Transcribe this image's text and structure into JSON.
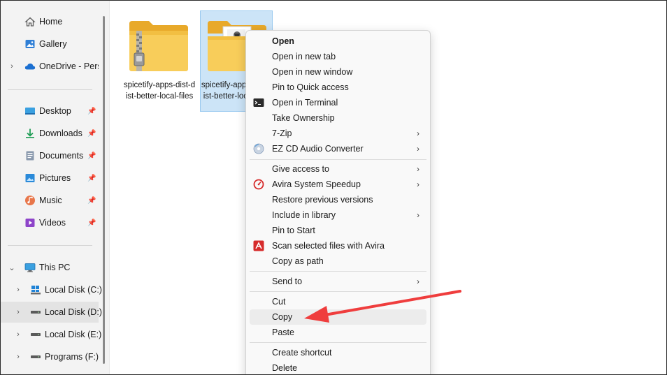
{
  "sidebar": {
    "quick": [
      {
        "label": "Home",
        "icon": "home-icon"
      },
      {
        "label": "Gallery",
        "icon": "gallery-icon"
      },
      {
        "label": "OneDrive - Pers",
        "icon": "onedrive-cloud-icon"
      }
    ],
    "pinned": [
      {
        "label": "Desktop",
        "icon": "desktop-folder-icon"
      },
      {
        "label": "Downloads",
        "icon": "downloads-folder-icon"
      },
      {
        "label": "Documents",
        "icon": "documents-folder-icon"
      },
      {
        "label": "Pictures",
        "icon": "pictures-folder-icon"
      },
      {
        "label": "Music",
        "icon": "music-folder-icon"
      },
      {
        "label": "Videos",
        "icon": "videos-folder-icon"
      }
    ],
    "this_pc": {
      "label": "This PC",
      "icon": "this-pc-icon"
    },
    "drives": [
      {
        "label": "Local Disk (C:)",
        "icon": "windows-drive-icon"
      },
      {
        "label": "Local Disk (D:)",
        "icon": "drive-icon"
      },
      {
        "label": "Local Disk (E:)",
        "icon": "drive-icon"
      },
      {
        "label": "Programs (F:)",
        "icon": "drive-icon"
      }
    ]
  },
  "files": [
    {
      "name": "spicetify-apps-dist-dist-better-local-files",
      "icon": "zip-folder-icon"
    },
    {
      "name": "spicetify-apps-dist-dist-better-local-files",
      "icon": "folder-icon"
    }
  ],
  "context_menu": {
    "group1": [
      {
        "label": "Open",
        "bold": true
      },
      {
        "label": "Open in new tab"
      },
      {
        "label": "Open in new window"
      },
      {
        "label": "Pin to Quick access"
      },
      {
        "label": "Open in Terminal",
        "icon": "terminal-icon"
      },
      {
        "label": "Take Ownership"
      },
      {
        "label": "7-Zip",
        "submenu": true
      },
      {
        "label": "EZ CD Audio Converter",
        "icon": "cd-icon",
        "submenu": true
      }
    ],
    "group2": [
      {
        "label": "Give access to",
        "submenu": true
      },
      {
        "label": "Avira System Speedup",
        "icon": "avira-speedup-icon",
        "submenu": true
      },
      {
        "label": "Restore previous versions"
      },
      {
        "label": "Include in library",
        "submenu": true
      },
      {
        "label": "Pin to Start"
      },
      {
        "label": "Scan selected files with Avira",
        "icon": "avira-icon"
      },
      {
        "label": "Copy as path"
      }
    ],
    "group3": [
      {
        "label": "Send to",
        "submenu": true
      }
    ],
    "group4": [
      {
        "label": "Cut"
      },
      {
        "label": "Copy"
      },
      {
        "label": "Paste"
      }
    ],
    "group5": [
      {
        "label": "Create shortcut"
      },
      {
        "label": "Delete"
      }
    ],
    "submenu_glyph": "›"
  },
  "colors": {
    "accent_arrow": "#ef3d3d",
    "selection": "#cce4f7",
    "folder": "#f5c542"
  }
}
